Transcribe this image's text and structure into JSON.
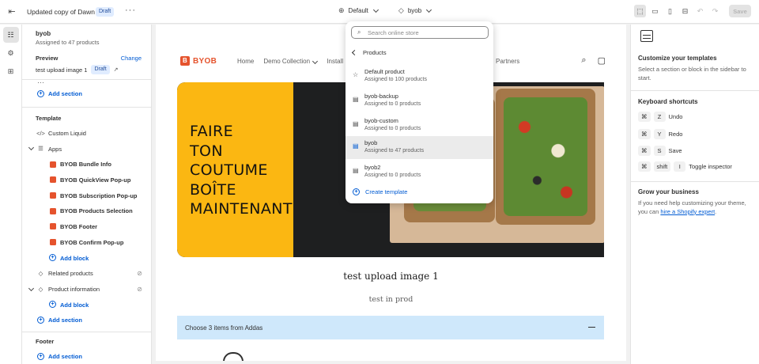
{
  "topbar": {
    "title": "Updated copy of Dawn",
    "draft_badge": "Draft",
    "theme_selector": "Default",
    "template_selector": "byob",
    "save_label": "Save"
  },
  "sidebar": {
    "header_title": "byob",
    "header_sub": "Assigned to 47 products",
    "preview_label": "Preview",
    "change_label": "Change",
    "preview_product": "test upload image 1",
    "preview_badge": "Draft",
    "add_section_1": "Add section",
    "template_label": "Template",
    "custom_liquid": "Custom Liquid",
    "apps_label": "Apps",
    "apps": [
      "BYOB Bundle Info",
      "BYOB QuickView Pop-up",
      "BYOB Subscription Pop-up",
      "BYOB Products Selection",
      "BYOB Footer",
      "BYOB Confirm Pop-up"
    ],
    "add_block_1": "Add block",
    "related_products": "Related products",
    "product_information": "Product information",
    "add_block_2": "Add block",
    "add_section_2": "Add section",
    "footer_label": "Footer",
    "add_section_3": "Add section"
  },
  "store": {
    "logo_text": "BYOB",
    "logo_mark": "B",
    "menu": [
      "Home",
      "Demo Collection",
      "Install"
    ],
    "partners": "Partners",
    "hero_lines": [
      "FAIRE",
      "TON",
      "COUTUME",
      "BOÎTE",
      "MAINTENANT"
    ],
    "product_title": "test upload image 1",
    "product_sub": "test in prod",
    "bundle_text": "Choose 3 items from Addas"
  },
  "dropdown": {
    "search_placeholder": "Search online store",
    "back_label": "Products",
    "items": [
      {
        "name": "Default product",
        "sub": "Assigned to 100 products",
        "icon": "star-icon"
      },
      {
        "name": "byob-backup",
        "sub": "Assigned to 0 products",
        "icon": "template-icon"
      },
      {
        "name": "byob-custom",
        "sub": "Assigned to 0 products",
        "icon": "template-icon"
      },
      {
        "name": "byob",
        "sub": "Assigned to 47 products",
        "icon": "template-icon"
      },
      {
        "name": "byob2",
        "sub": "Assigned to 0 products",
        "icon": "template-icon"
      }
    ],
    "create_label": "Create template"
  },
  "rpanel": {
    "title": "Customize your templates",
    "text": "Select a section or block in the sidebar to start.",
    "shortcuts_title": "Keyboard shortcuts",
    "shortcuts": [
      {
        "keys": [
          "Z"
        ],
        "label": "Undo"
      },
      {
        "keys": [
          "Y"
        ],
        "label": "Redo"
      },
      {
        "keys": [
          "S"
        ],
        "label": "Save"
      },
      {
        "keys": [
          "shift",
          "I"
        ],
        "label": "Toggle inspector"
      }
    ],
    "grow_title": "Grow your business",
    "grow_text": "If you need help customizing your theme, you can",
    "grow_link": "hire a Shopify expert",
    "grow_end": "."
  },
  "colors": {
    "accent": "#005bd3",
    "brand": "#e5532d",
    "hero_yellow": "#fbb712",
    "bundle_bar": "#cfe8fb"
  }
}
